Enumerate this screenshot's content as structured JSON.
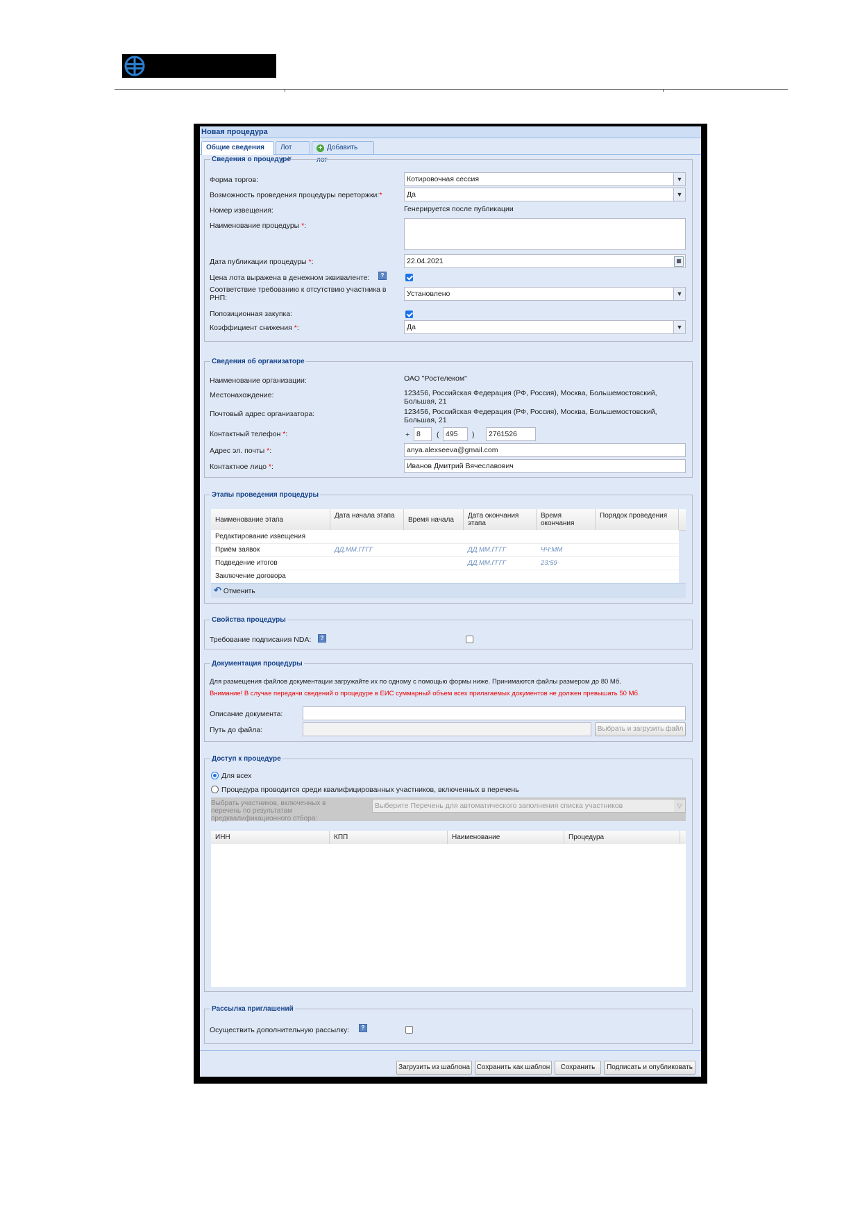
{
  "window": {
    "title": "Новая процедура"
  },
  "tabs": [
    {
      "label": "Общие сведения"
    },
    {
      "label": "Лот 1"
    },
    {
      "label": "Добавить лот"
    }
  ],
  "procedure_info": {
    "legend": "Сведения о процедуре",
    "form_label": "Форма торгов:",
    "form_value": "Котировочная сессия",
    "rebid_label": "Возможность проведения процедуры переторжки:",
    "rebid_value": "Да",
    "notice_label": "Номер извещения:",
    "notice_value": "Генерируется после публикации",
    "name_label": "Наименование процедуры",
    "name_value": "",
    "pubdate_label": "Дата публикации процедуры",
    "pubdate_value": "22.04.2021",
    "price_label": "Цена лота выражена в денежном эквиваленте:",
    "rnp_label": "Соответствие требованию к отсутствию участника в РНП:",
    "rnp_value": "Установлено",
    "positional_label": "Попозиционная закупка:",
    "coef_label": "Коэффициент снижения",
    "coef_value": "Да"
  },
  "organizer": {
    "legend": "Сведения об организаторе",
    "org_label": "Наименование организации:",
    "org_value": "ОАО \"Ростелеком\"",
    "location_label": "Местонахождение:",
    "location_line1": "123456, Российская Федерация (РФ, Россия), Москва, Большемостовский,",
    "location_line2": "Большая, 21",
    "postal_label": "Почтовый адрес организатора:",
    "postal_line1": "123456, Российская Федерация (РФ, Россия), Москва, Большемостовский,",
    "postal_line2": "Большая, 21",
    "phone_label": "Контактный телефон",
    "phone_plus": "+",
    "phone_country": "8",
    "phone_open": "(",
    "phone_code": "495",
    "phone_close": ")",
    "phone_number": "2761526",
    "email_label": "Адрес эл. почты",
    "email_value": "anya.alexseeva@gmail.com",
    "contact_label": "Контактное лицо",
    "contact_value": "Иванов Дмитрий Вячеславович"
  },
  "stages": {
    "legend": "Этапы проведения процедуры",
    "columns": [
      "Наименование этапа",
      "Дата начала этапа",
      "Время начала",
      "Дата окончания этапа",
      "Время окончания",
      "Порядок проведения"
    ],
    "rows": [
      {
        "name": "Редактирование извещения",
        "start_date": "",
        "start_time": "",
        "end_date": "",
        "end_time": "",
        "order": ""
      },
      {
        "name": "Приём заявок",
        "start_date": "ДД.ММ.ГГГГ",
        "start_time": "",
        "end_date": "ДД.ММ.ГГГГ",
        "end_time": "ЧЧ:ММ",
        "order": ""
      },
      {
        "name": "Подведение итогов",
        "start_date": "",
        "start_time": "",
        "end_date": "ДД.ММ.ГГГГ",
        "end_time": "23:59",
        "order": ""
      },
      {
        "name": "Заключение договора",
        "start_date": "",
        "start_time": "",
        "end_date": "",
        "end_time": "",
        "order": ""
      }
    ],
    "cancel_label": "Отменить"
  },
  "properties": {
    "legend": "Свойства процедуры",
    "nda_label": "Требование подписания NDA:"
  },
  "documentation": {
    "legend": "Документация процедуры",
    "info": "Для размещения файлов документации загружайте их по одному с помощью формы ниже. Принимаются файлы размером до 80 Мб.",
    "warning": "Внимание! В случае передачи сведений о процедуре в ЕИС суммарный объем всех прилагаемых документов не должен превышать 50 Мб.",
    "desc_label": "Описание документа:",
    "desc_value": "",
    "path_label": "Путь до файла:",
    "path_value": "",
    "upload_button": "Выбрать и загрузить файл"
  },
  "access": {
    "legend": "Доступ к процедуре",
    "option_all": "Для всех",
    "option_qualified": "Процедура проводится среди квалифицированных участников, включенных в перечень",
    "select_label_line1": "Выбрать участников, включенных в",
    "select_label_line2": "перечень по результатам",
    "select_label_line3": "предквалификационного отбора:",
    "select_placeholder": "Выберите Перечень для автоматического заполнения списка участников",
    "columns": [
      "ИНН",
      "КПП",
      "Наименование",
      "Процедура"
    ]
  },
  "invitations": {
    "legend": "Рассылка приглашений",
    "extra_label": "Осуществить дополнительную рассылку:"
  },
  "footer": {
    "load_template": "Загрузить из шаблона",
    "save_template": "Сохранить как шаблон",
    "save": "Сохранить",
    "sign_publish": "Подписать и опубликовать"
  }
}
